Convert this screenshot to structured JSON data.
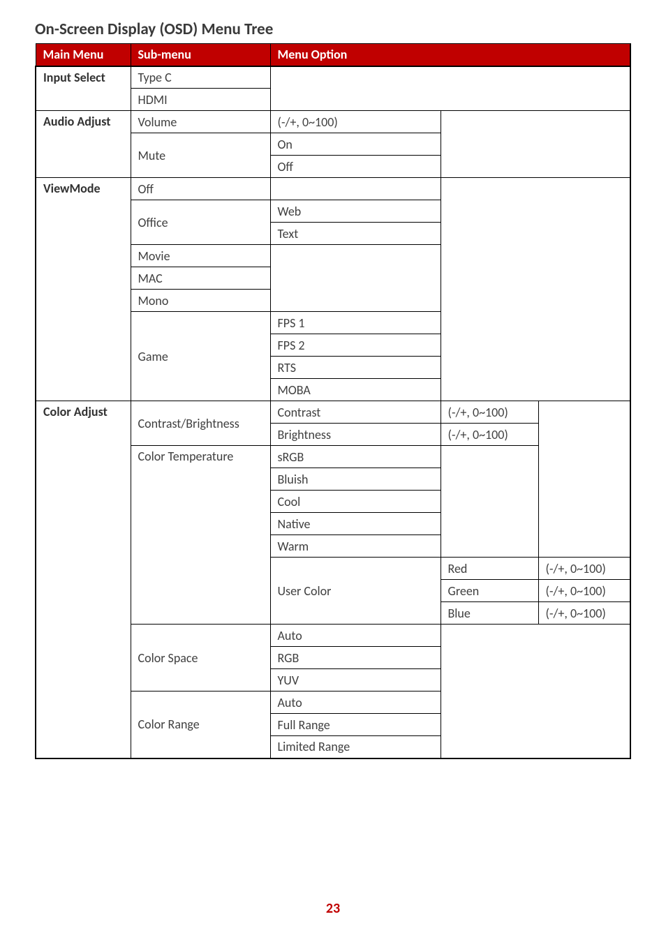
{
  "title": "On-Screen Display (OSD) Menu Tree",
  "page_number": "23",
  "headers": {
    "main_menu": "Main Menu",
    "sub_menu": "Sub-menu",
    "menu_option": "Menu Option"
  },
  "range": "(-/+, 0~100)",
  "sections": {
    "input_select": {
      "label": "Input Select",
      "items": [
        "Type C",
        "HDMI"
      ]
    },
    "audio_adjust": {
      "label": "Audio Adjust",
      "volume": "Volume",
      "mute": "Mute",
      "mute_on": "On",
      "mute_off": "Off"
    },
    "view_mode": {
      "label": "ViewMode",
      "off": "Off",
      "office": "Office",
      "office_web": "Web",
      "office_text": "Text",
      "movie": "Movie",
      "mac": "MAC",
      "mono": "Mono",
      "game": "Game",
      "game_items": [
        "FPS 1",
        "FPS 2",
        "RTS",
        "MOBA"
      ]
    },
    "color_adjust": {
      "label": "Color Adjust",
      "contrast_brightness": "Contrast/Brightness",
      "contrast": "Contrast",
      "brightness": "Brightness",
      "color_temperature": "Color Temperature",
      "ct_items": [
        "sRGB",
        "Bluish",
        "Cool",
        "Native",
        "Warm"
      ],
      "user_color": "User Color",
      "uc_red": "Red",
      "uc_green": "Green",
      "uc_blue": "Blue",
      "color_space": "Color Space",
      "cs_items": [
        "Auto",
        "RGB",
        "YUV"
      ],
      "color_range": "Color Range",
      "cr_items": [
        "Auto",
        "Full Range",
        "Limited Range"
      ]
    }
  }
}
